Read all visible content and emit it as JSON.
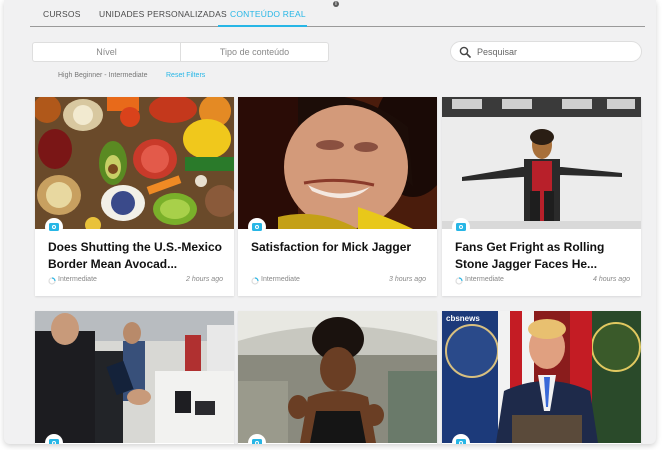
{
  "tabs": [
    {
      "label": "CURSOS",
      "active": false
    },
    {
      "label": "UNIDADES PERSONALIZADAS",
      "active": false
    },
    {
      "label": "CONTEÚDO REAL",
      "active": true
    }
  ],
  "info_badge": "i",
  "filters": {
    "level": "Nível",
    "content_type": "Tipo de conteúdo"
  },
  "search": {
    "placeholder": "Pesquisar"
  },
  "active_filter": {
    "level_text": "High Beginner - Intermediate",
    "reset_label": "Reset Filters"
  },
  "accent_color": "#27b6e6",
  "cards": [
    {
      "title": "Does Shutting the U.S.-Mexico Border Mean Avocad...",
      "level": "Intermediate",
      "time": "2 hours ago",
      "thumb": "vegetables-food-photo"
    },
    {
      "title": "Satisfaction for Mick Jagger",
      "level": "Intermediate",
      "time": "3 hours ago",
      "thumb": "mick-jagger-closeup-photo"
    },
    {
      "title": "Fans Get Fright as Rolling Stone Jagger Faces He...",
      "level": "Intermediate",
      "time": "4 hours ago",
      "thumb": "jagger-on-stage-photo"
    },
    {
      "title": "",
      "level": "",
      "time": "",
      "thumb": "tech-expo-photo"
    },
    {
      "title": "",
      "level": "",
      "time": "",
      "thumb": "woman-vlog-photo"
    },
    {
      "title": "",
      "level": "",
      "time": "",
      "thumb": "president-border-press-photo"
    }
  ],
  "watermark": "cbsnews"
}
